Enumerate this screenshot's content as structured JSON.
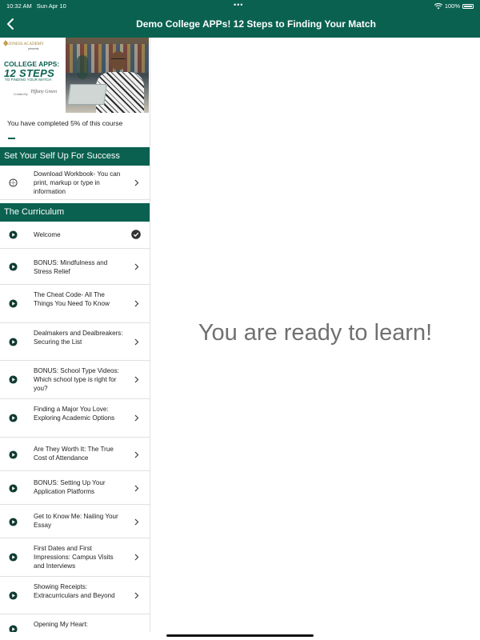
{
  "status_bar": {
    "time": "10:32 AM",
    "date": "Sun Apr 10",
    "battery": "100%",
    "icons": [
      "wifi-icon",
      "battery-icon"
    ]
  },
  "header": {
    "title": "Demo College APPs! 12 Steps to Finding Your Match",
    "back_icon": "chevron-left-icon"
  },
  "course_image": {
    "academy_name": "LIONESS ACADEMY",
    "presents": "presents",
    "line1": "COLLEGE APPS:",
    "line2": "12 STEPS",
    "line3": "TO FINDING YOUR MATCH",
    "created_by": "Created By:",
    "signature": "Tiffany Green"
  },
  "progress": {
    "text": "You have completed 5% of this course",
    "fraction": 0.05
  },
  "sections": [
    {
      "title": "Set Your Self Up For Success",
      "items": [
        {
          "label": "Download Workbook- You can print, markup or type in information",
          "icon": "globe-icon",
          "completed": false
        }
      ]
    },
    {
      "title": "The Curriculum",
      "items": [
        {
          "label": "Welcome",
          "icon": "play-icon",
          "completed": true
        },
        {
          "label": "BONUS: Mindfulness and Stress Relief",
          "icon": "play-icon",
          "completed": false
        },
        {
          "label": "The Cheat Code- All The Things You Need To Know",
          "icon": "play-icon",
          "completed": false
        },
        {
          "label": "Dealmakers and Dealbreakers: Securing the List",
          "icon": "play-icon",
          "completed": false
        },
        {
          "label": "BONUS: School Type Videos: Which school type is right for you?",
          "icon": "play-icon",
          "completed": false
        },
        {
          "label": "Finding a Major You Love: Exploring Academic Options",
          "icon": "play-icon",
          "completed": false
        },
        {
          "label": "Are They Worth It: The True Cost of Attendance",
          "icon": "play-icon",
          "completed": false
        },
        {
          "label": "BONUS: Setting Up Your Application Platforms",
          "icon": "play-icon",
          "completed": false
        },
        {
          "label": "Get to Know Me: Nailing Your Essay",
          "icon": "play-icon",
          "completed": false
        },
        {
          "label": "First Dates and First Impressions: Campus Visits and Interviews",
          "icon": "play-icon",
          "completed": false
        },
        {
          "label": "Showing Receipts: Extracurriculars and Beyond",
          "icon": "play-icon",
          "completed": false
        },
        {
          "label": "Opening My Heart:",
          "icon": "play-icon",
          "completed": false
        }
      ]
    }
  ],
  "main": {
    "message": "You are ready to learn!"
  },
  "colors": {
    "brand": "#0a6150",
    "message_text": "#707070"
  }
}
